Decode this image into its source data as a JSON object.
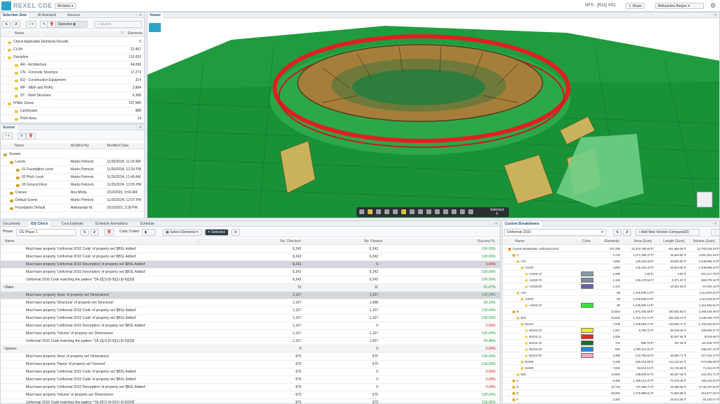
{
  "app": {
    "title": "REXEL CDE",
    "modules_label": "Modules",
    "project": "NFS - [R11] V02",
    "share_label": "Share",
    "user": "Aleksandra Banjac"
  },
  "selection_sets": {
    "tabs": [
      "Selection Sets",
      "AI Assistant",
      "Sources"
    ],
    "mode_label": "Selection",
    "search_placeholder": "Search...",
    "col_name": "Name",
    "col_elements": "Elements",
    "rows": [
      {
        "name": "Check Applicable Elements Results",
        "value": "0",
        "level": 1
      },
      {
        "name": "CLSH",
        "value": "22,457",
        "level": 1
      },
      {
        "name": "Discipline",
        "value": "110,653",
        "level": 1
      },
      {
        "name": "AR - Architecture",
        "value": "64,096",
        "level": 2
      },
      {
        "name": "CN - Concrete Structure",
        "value": "17,273",
        "level": 2
      },
      {
        "name": "EQ - Construction Equipment",
        "value": "314",
        "level": 2
      },
      {
        "name": "MP - MEP and HVAC",
        "value": "2,884",
        "level": 2
      },
      {
        "name": "ST - Steel Structure",
        "value": "6,368",
        "level": 2
      },
      {
        "name": "FINAL Zones",
        "value": "107,585",
        "level": 1
      },
      {
        "name": "Landscape",
        "value": "888",
        "level": 2
      },
      {
        "name": "Pitch Area",
        "value": "14",
        "level": 2
      }
    ]
  },
  "scenes": {
    "tab": "Scenes",
    "cols": [
      "Name",
      "Modified By",
      "Modified Date"
    ],
    "rows": [
      {
        "name": "Scenes",
        "by": "",
        "date": "",
        "level": 0
      },
      {
        "name": "Levels",
        "by": "Marko Petrovic",
        "date": "11/26/2024, 11:26 AM",
        "level": 1
      },
      {
        "name": "01 Foundation Level",
        "by": "Marko Petrovic",
        "date": "11/26/2024, 12:24 PM",
        "level": 2
      },
      {
        "name": "02 Pitch Level",
        "by": "Marko Petrovic",
        "date": "11/26/2024, 11:49 AM",
        "level": 2
      },
      {
        "name": "03 Ground Floor",
        "by": "Marko Petrovic",
        "date": "11/26/2024, 12:05 PM",
        "level": 2
      },
      {
        "name": "Cranes",
        "by": "Ana Mirda",
        "date": "2/19/2025, 9:06 AM",
        "level": 1
      },
      {
        "name": "Default Scene",
        "by": "Marko Petrovic",
        "date": "11/26/2024, 12:07 PM",
        "level": 1
      },
      {
        "name": "Foundation Default",
        "by": "Aleksandar M.",
        "date": "3/10/2025, 3:28 PM",
        "level": 1
      }
    ]
  },
  "viewer": {
    "tab": "Viewer",
    "selected_label": "Selected",
    "selected_count": "0"
  },
  "ids": {
    "tabs": [
      "Documents",
      "IDS Check",
      "Cost Estimate",
      "Schedule Animations",
      "Schedule"
    ],
    "phase_label": "Phase:",
    "phase_value": "OS Phase 1",
    "color_coded_label": "Color Coded",
    "select_elements_label": "Select Elements",
    "selected_label": "Selected",
    "cols": [
      "Name",
      "No. Checked",
      "No. Passed",
      "Success %"
    ],
    "rows": [
      {
        "name": "Must have property 'Uniformat 2010 Code' of property set '$BSL Added'",
        "checked": "6,242",
        "passed": "6,242",
        "pct": "100.00%",
        "status": "ok",
        "kind": "item"
      },
      {
        "name": "Must have property 'Uniformat 2010 Code' of property set '$BSL Added'",
        "checked": "6,242",
        "passed": "6,242",
        "pct": "100.00%",
        "status": "ok",
        "kind": "item"
      },
      {
        "name": "Must have property 'Uniformat 2010 Description' of property set '$BSL Added'",
        "checked": "6,242",
        "passed": "0",
        "pct": "0.00%",
        "status": "bad",
        "kind": "sel"
      },
      {
        "name": "Must have property 'Uniformat 2010 Description' of property set '$BSL Added'",
        "checked": "6,242",
        "passed": "6,242",
        "pct": "100.00%",
        "status": "ok",
        "kind": "item"
      },
      {
        "name": "Uniformat 2010 Code matching the pattern '^[A-Z]{1}-[0-9]{1}-[0-9]{3}$'",
        "checked": "6,242",
        "passed": "6,242",
        "pct": "100.00%",
        "status": "ok",
        "kind": "item"
      },
      {
        "name": "Slabs",
        "checked": "12",
        "passed": "11",
        "pct": "91.67%",
        "status": "ok",
        "kind": "group"
      },
      {
        "name": "Must have property 'Area' of property set 'Dimensions'",
        "checked": "1,107",
        "passed": "1,107",
        "pct": "100.00%",
        "status": "ok",
        "kind": "sel"
      },
      {
        "name": "Must have property 'Structural' of property set 'Structural'",
        "checked": "1,107",
        "passed": "1,098",
        "pct": "99.19%",
        "status": "ok",
        "kind": "item"
      },
      {
        "name": "Must have property 'Uniformat 2010 Code' of property set '$BSL Added'",
        "checked": "1,107",
        "passed": "1,107",
        "pct": "100.00%",
        "status": "ok",
        "kind": "item"
      },
      {
        "name": "Must have property 'Uniformat 2010 Code' of property set '$BSL Added'",
        "checked": "1,107",
        "passed": "1,107",
        "pct": "100.00%",
        "status": "ok",
        "kind": "item"
      },
      {
        "name": "Must have property 'Uniformat 2010 Description' of property set '$BSL Added'",
        "checked": "1,107",
        "passed": "0",
        "pct": "0.00%",
        "status": "bad",
        "kind": "item"
      },
      {
        "name": "Must have property 'Volume' of property set 'Dimensions'",
        "checked": "1,107",
        "passed": "1,107",
        "pct": "100.00%",
        "status": "ok",
        "kind": "item"
      },
      {
        "name": "Uniformat 2010 Code matching the pattern '^[A-Z]{1}-[0-9]{1}-[0-9]{3}$'",
        "checked": "1,107",
        "passed": "1,057",
        "pct": "95.48%",
        "status": "ok",
        "kind": "item"
      },
      {
        "name": "Spaces",
        "checked": "0",
        "passed": "0",
        "pct": "0.00%",
        "status": "bad",
        "kind": "group"
      },
      {
        "name": "Must have property 'Area' of property set 'Dimensions'",
        "checked": "975",
        "passed": "975",
        "pct": "100.00%",
        "status": "ok",
        "kind": "item"
      },
      {
        "name": "Must have property 'Name' of property set 'General'",
        "checked": "975",
        "passed": "975",
        "pct": "100.00%",
        "status": "ok",
        "kind": "item"
      },
      {
        "name": "Must have property 'Uniformat 2010 Code' of property set '$BSL Added'",
        "checked": "975",
        "passed": "0",
        "pct": "0.00%",
        "status": "bad",
        "kind": "item"
      },
      {
        "name": "Must have property 'Uniformat 2010 Code' of property set '$BSL Added'",
        "checked": "975",
        "passed": "0",
        "pct": "0.00%",
        "status": "bad",
        "kind": "item"
      },
      {
        "name": "Must have property 'Uniformat 2010 Description' of property set '$BSL Added'",
        "checked": "975",
        "passed": "0",
        "pct": "0.00%",
        "status": "bad",
        "kind": "item"
      },
      {
        "name": "Must have property 'Volume' of property set 'Dimensions'",
        "checked": "975",
        "passed": "975",
        "pct": "100.00%",
        "status": "ok",
        "kind": "item"
      },
      {
        "name": "Uniformat 2010 Code matching the pattern '^[A-Z]{1}-[0-9]{1}-[0-9]{3}$'",
        "checked": "975",
        "passed": "975",
        "pct": "100.00%",
        "status": "ok",
        "kind": "item"
      }
    ]
  },
  "breakdown": {
    "tab": "Custom Breakdowns",
    "select_value": "Uniformat 2010",
    "add_label": "Add New Version Compare(ID)",
    "cols": [
      "Name",
      "Color",
      "Elements",
      "Area (Sum)",
      "Length (Sum)",
      "Volume (Sum)"
    ],
    "rows": [
      {
        "name": "Custom Breakdown Uniformat 2010",
        "color": "",
        "el": "107,288",
        "area": "10,203,788.60 ft²",
        "len": "821,558.08 ft",
        "vol": "12,750,536.19 ft³",
        "level": 0
      },
      {
        "name": "A",
        "color": "",
        "el": "4,744",
        "area": "1,071,088.47 ft²",
        "len": "28,823.80 ft",
        "vol": "2,681,301.23 ft³",
        "level": 1
      },
      {
        "name": "A10",
        "color": "",
        "el": "4,656",
        "area": "145,183.33 ft²",
        "len": "28,823.80 ft",
        "vol": "1,448,996.42 ft³",
        "level": 2
      },
      {
        "name": "A1020",
        "color": "",
        "el": "4,656",
        "area": "145,183.33 ft²",
        "len": "28,823.80 ft",
        "vol": "1,448,996.42 ft³",
        "level": 3
      },
      {
        "name": "A1020.10",
        "color": "#8a9aa3",
        "el": "2,389",
        "area": "1.80 ft²",
        "len": "0.00 ft",
        "vol": "831,317.79 ft³",
        "level": 4
      },
      {
        "name": "A1020.70",
        "color": "#7b8c96",
        "el": "1,160",
        "area": "145,178.53 ft²",
        "len": "8,371.97 ft",
        "vol": "550,078.22 ft³",
        "level": 4
      },
      {
        "name": "A1020.80",
        "color": "#6a5fb0",
        "el": "1,104",
        "area": "",
        "len": "18,451.83 ft",
        "vol": "67,600.44 ft³",
        "level": 4
      },
      {
        "name": "A40",
        "color": "",
        "el": "88",
        "area": "1,225,808.14 ft²",
        "len": "",
        "vol": "1,112,604.81 ft³",
        "level": 2
      },
      {
        "name": "A4020",
        "color": "",
        "el": "88",
        "area": "1,225,808.14 ft²",
        "len": "",
        "vol": "1,112,604.81 ft³",
        "level": 3
      },
      {
        "name": "A4020.10",
        "color": "#33e633",
        "el": "88",
        "area": "1,225,808.14 ft²",
        "len": "",
        "vol": "1,112,604.81 ft³",
        "level": 4
      },
      {
        "name": "B",
        "color": "",
        "el": "33,584",
        "area": "1,872,393.58 ft²",
        "len": "400,802.83 ft",
        "vol": "2,450,548.46 ft³",
        "level": 1
      },
      {
        "name": "B10",
        "color": "",
        "el": "20,002",
        "area": "1,723,741.71 ft²",
        "len": "332,435.47 ft",
        "vol": "2,348,048.73 ft³",
        "level": 2
      },
      {
        "name": "B1010",
        "color": "",
        "el": "7,009",
        "area": "1,348,893.71 ft²",
        "len": "128,662.17 ft",
        "vol": "1,703,826.84 ft³",
        "level": 3
      },
      {
        "name": "B1010.10",
        "color": "#f2ee1a",
        "el": "1,267",
        "area": "5,799.72 ft²",
        "len": "59,318.18 ft",
        "vol": "206,509.27 ft³",
        "level": 4
      },
      {
        "name": "B1010.11",
        "color": "#e8271c",
        "el": "1,058",
        "area": "",
        "len": "30,547.92 ft",
        "vol": "8,019.95 ft³",
        "level": 4
      },
      {
        "name": "B1010.15",
        "color": "#1c6b2e",
        "el": "704",
        "area": "686.78 ft²",
        "len": "187.39 ft",
        "vol": "111,626.73 ft³",
        "level": 4
      },
      {
        "name": "B1010.20",
        "color": "#1a8fd8",
        "el": "583",
        "area": "1,099,511.91 ft²",
        "len": "",
        "vol": "845,047.42 ft³",
        "level": 4
      },
      {
        "name": "B1010.90",
        "color": "#f4a6c0",
        "el": "3,399",
        "area": "242,783.63 ft²",
        "len": "48,550.71 ft",
        "vol": "527,423.47 ft³",
        "level": 4
      },
      {
        "name": "B1020",
        "color": "",
        "el": "3,188",
        "area": "280,434.88 ft²",
        "len": "144,110.61 ft",
        "vol": "573,088.08 ft³",
        "level": 3
      },
      {
        "name": "B1080",
        "color": "",
        "el": "7,605",
        "area": "94,813.12 ft²",
        "len": "51,734.88 ft",
        "vol": "71,351.01 ft³",
        "level": 3
      },
      {
        "name": "B20",
        "color": "",
        "el": "13,582",
        "area": "248,808.67 ft²",
        "len": "68,467.48 ft",
        "vol": "102,301.71 ft³",
        "level": 2
      },
      {
        "name": "C",
        "color": "",
        "el": "5,486",
        "area": "1,180,212.47 ft²",
        "len": "76,278.29 ft",
        "vol": "539,116.51 ft³",
        "level": 1
      },
      {
        "name": "D",
        "color": "",
        "el": "10,734",
        "area": "747,388.71 ft²",
        "len": "16,388.68 ft",
        "vol": "3,745,347.53 ft³",
        "level": 1
      },
      {
        "name": "E",
        "color": "",
        "el": "48,002",
        "area": "1,075,889.81 ft²",
        "len": "72,583.88 ft",
        "vol": "213,877.52 ft³",
        "level": 1
      },
      {
        "name": "F",
        "color": "",
        "el": "2,387",
        "area": "",
        "len": "28,013.08 ft",
        "vol": "65,180.07 ft³",
        "level": 1
      }
    ]
  }
}
